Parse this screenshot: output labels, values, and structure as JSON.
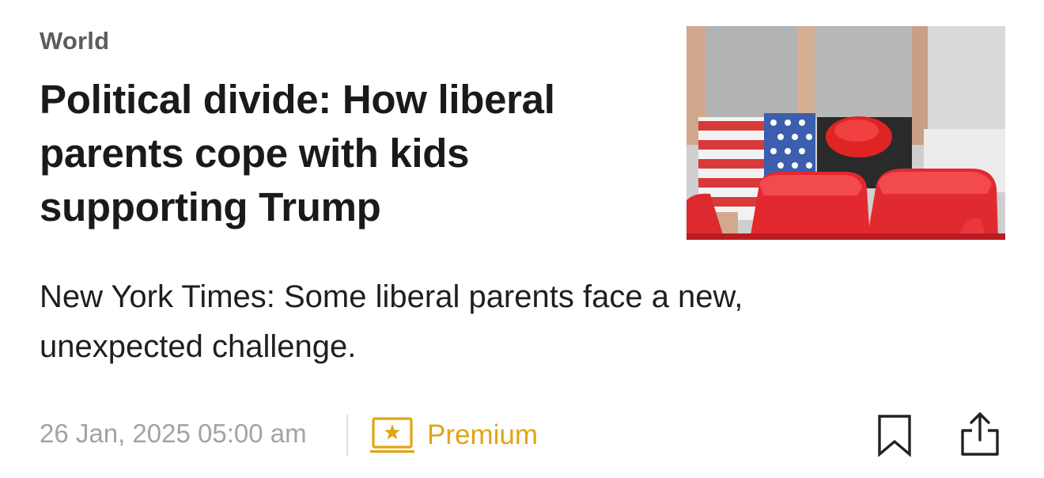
{
  "article": {
    "category": "World",
    "headline": "Political divide: How liberal parents cope with kids supporting Trump",
    "summary": "New York Times: Some liberal parents face a new, unexpected challenge.",
    "timestamp": "26 Jan, 2025 05:00 am",
    "premium_label": "Premium"
  },
  "icons": {
    "premium": "premium-star-icon",
    "bookmark": "bookmark-icon",
    "share": "share-icon"
  },
  "colors": {
    "category": "#5c5c5c",
    "headline": "#1a1a1a",
    "summary": "#1f1f1f",
    "timestamp": "#a3a3a3",
    "premium_accent": "#e0a512",
    "icon_stroke": "#222222"
  }
}
